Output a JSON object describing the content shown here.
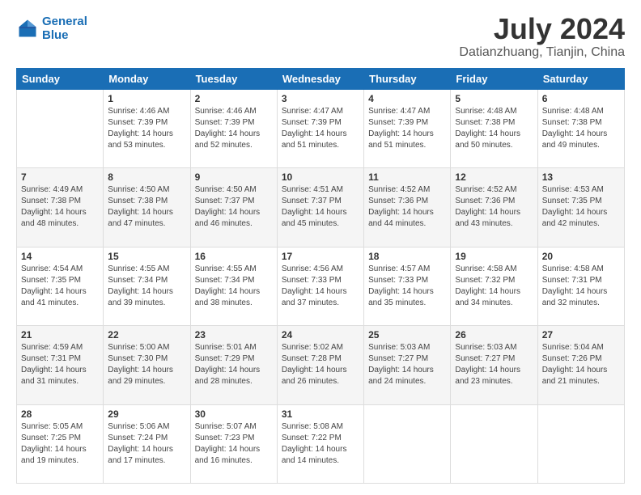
{
  "header": {
    "logo_line1": "General",
    "logo_line2": "Blue",
    "title": "July 2024",
    "subtitle": "Datianzhuang, Tianjin, China"
  },
  "days_of_week": [
    "Sunday",
    "Monday",
    "Tuesday",
    "Wednesday",
    "Thursday",
    "Friday",
    "Saturday"
  ],
  "weeks": [
    [
      {
        "day": "",
        "content": ""
      },
      {
        "day": "1",
        "content": "Sunrise: 4:46 AM\nSunset: 7:39 PM\nDaylight: 14 hours\nand 53 minutes."
      },
      {
        "day": "2",
        "content": "Sunrise: 4:46 AM\nSunset: 7:39 PM\nDaylight: 14 hours\nand 52 minutes."
      },
      {
        "day": "3",
        "content": "Sunrise: 4:47 AM\nSunset: 7:39 PM\nDaylight: 14 hours\nand 51 minutes."
      },
      {
        "day": "4",
        "content": "Sunrise: 4:47 AM\nSunset: 7:39 PM\nDaylight: 14 hours\nand 51 minutes."
      },
      {
        "day": "5",
        "content": "Sunrise: 4:48 AM\nSunset: 7:38 PM\nDaylight: 14 hours\nand 50 minutes."
      },
      {
        "day": "6",
        "content": "Sunrise: 4:48 AM\nSunset: 7:38 PM\nDaylight: 14 hours\nand 49 minutes."
      }
    ],
    [
      {
        "day": "7",
        "content": "Sunrise: 4:49 AM\nSunset: 7:38 PM\nDaylight: 14 hours\nand 48 minutes."
      },
      {
        "day": "8",
        "content": "Sunrise: 4:50 AM\nSunset: 7:38 PM\nDaylight: 14 hours\nand 47 minutes."
      },
      {
        "day": "9",
        "content": "Sunrise: 4:50 AM\nSunset: 7:37 PM\nDaylight: 14 hours\nand 46 minutes."
      },
      {
        "day": "10",
        "content": "Sunrise: 4:51 AM\nSunset: 7:37 PM\nDaylight: 14 hours\nand 45 minutes."
      },
      {
        "day": "11",
        "content": "Sunrise: 4:52 AM\nSunset: 7:36 PM\nDaylight: 14 hours\nand 44 minutes."
      },
      {
        "day": "12",
        "content": "Sunrise: 4:52 AM\nSunset: 7:36 PM\nDaylight: 14 hours\nand 43 minutes."
      },
      {
        "day": "13",
        "content": "Sunrise: 4:53 AM\nSunset: 7:35 PM\nDaylight: 14 hours\nand 42 minutes."
      }
    ],
    [
      {
        "day": "14",
        "content": "Sunrise: 4:54 AM\nSunset: 7:35 PM\nDaylight: 14 hours\nand 41 minutes."
      },
      {
        "day": "15",
        "content": "Sunrise: 4:55 AM\nSunset: 7:34 PM\nDaylight: 14 hours\nand 39 minutes."
      },
      {
        "day": "16",
        "content": "Sunrise: 4:55 AM\nSunset: 7:34 PM\nDaylight: 14 hours\nand 38 minutes."
      },
      {
        "day": "17",
        "content": "Sunrise: 4:56 AM\nSunset: 7:33 PM\nDaylight: 14 hours\nand 37 minutes."
      },
      {
        "day": "18",
        "content": "Sunrise: 4:57 AM\nSunset: 7:33 PM\nDaylight: 14 hours\nand 35 minutes."
      },
      {
        "day": "19",
        "content": "Sunrise: 4:58 AM\nSunset: 7:32 PM\nDaylight: 14 hours\nand 34 minutes."
      },
      {
        "day": "20",
        "content": "Sunrise: 4:58 AM\nSunset: 7:31 PM\nDaylight: 14 hours\nand 32 minutes."
      }
    ],
    [
      {
        "day": "21",
        "content": "Sunrise: 4:59 AM\nSunset: 7:31 PM\nDaylight: 14 hours\nand 31 minutes."
      },
      {
        "day": "22",
        "content": "Sunrise: 5:00 AM\nSunset: 7:30 PM\nDaylight: 14 hours\nand 29 minutes."
      },
      {
        "day": "23",
        "content": "Sunrise: 5:01 AM\nSunset: 7:29 PM\nDaylight: 14 hours\nand 28 minutes."
      },
      {
        "day": "24",
        "content": "Sunrise: 5:02 AM\nSunset: 7:28 PM\nDaylight: 14 hours\nand 26 minutes."
      },
      {
        "day": "25",
        "content": "Sunrise: 5:03 AM\nSunset: 7:27 PM\nDaylight: 14 hours\nand 24 minutes."
      },
      {
        "day": "26",
        "content": "Sunrise: 5:03 AM\nSunset: 7:27 PM\nDaylight: 14 hours\nand 23 minutes."
      },
      {
        "day": "27",
        "content": "Sunrise: 5:04 AM\nSunset: 7:26 PM\nDaylight: 14 hours\nand 21 minutes."
      }
    ],
    [
      {
        "day": "28",
        "content": "Sunrise: 5:05 AM\nSunset: 7:25 PM\nDaylight: 14 hours\nand 19 minutes."
      },
      {
        "day": "29",
        "content": "Sunrise: 5:06 AM\nSunset: 7:24 PM\nDaylight: 14 hours\nand 17 minutes."
      },
      {
        "day": "30",
        "content": "Sunrise: 5:07 AM\nSunset: 7:23 PM\nDaylight: 14 hours\nand 16 minutes."
      },
      {
        "day": "31",
        "content": "Sunrise: 5:08 AM\nSunset: 7:22 PM\nDaylight: 14 hours\nand 14 minutes."
      },
      {
        "day": "",
        "content": ""
      },
      {
        "day": "",
        "content": ""
      },
      {
        "day": "",
        "content": ""
      }
    ]
  ]
}
